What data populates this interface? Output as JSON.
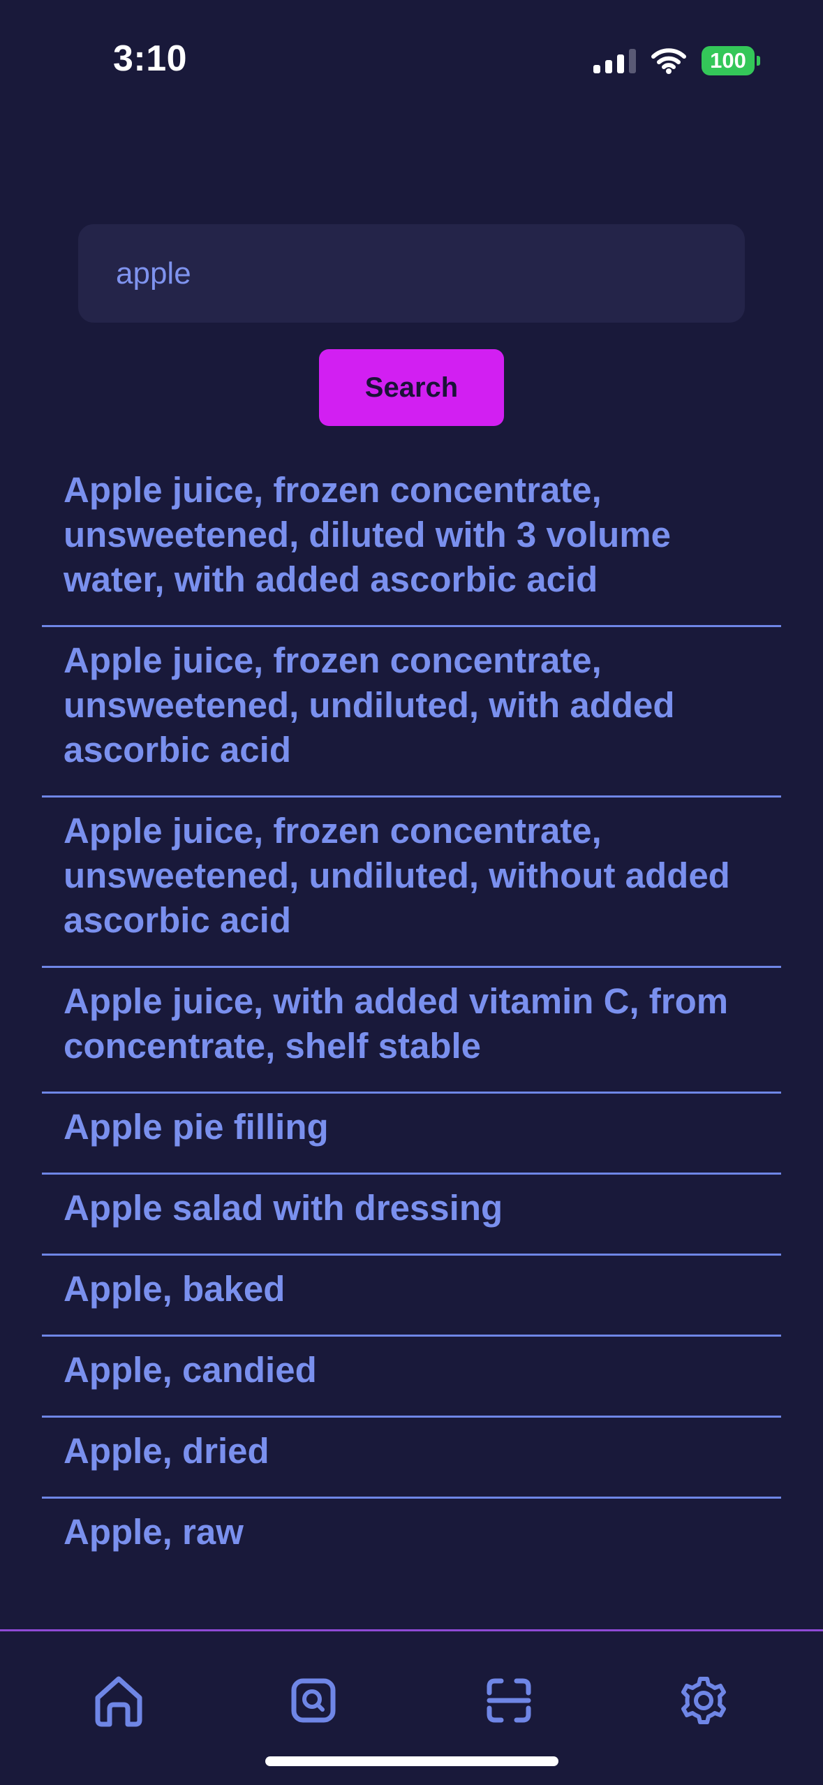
{
  "status_bar": {
    "time": "3:10",
    "battery": "100",
    "icons": [
      "cellular-signal-icon",
      "wifi-icon",
      "battery-icon"
    ]
  },
  "search": {
    "value": "apple",
    "button_label": "Search"
  },
  "results": [
    "Apple juice, frozen concentrate, unsweetened, diluted with 3 volume water, with added ascorbic acid",
    "Apple juice, frozen concentrate, unsweetened, undiluted, with added ascorbic acid",
    "Apple juice, frozen concentrate, unsweetened, undiluted, without added ascorbic acid",
    "Apple juice, with added vitamin C, from concentrate, shelf stable",
    "Apple pie filling",
    "Apple salad with dressing",
    "Apple, baked",
    "Apple, candied",
    "Apple, dried",
    "Apple, raw"
  ],
  "tab_bar": {
    "tabs": [
      "home-icon",
      "search-icon",
      "scan-icon",
      "settings-icon"
    ]
  },
  "colors": {
    "background": "#19193a",
    "accent": "#d21ff2",
    "text": "#7a90ee",
    "battery": "#34c759"
  }
}
